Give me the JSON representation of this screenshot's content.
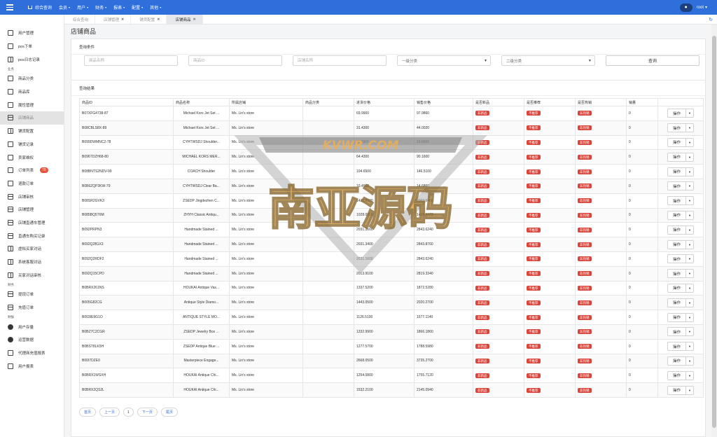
{
  "topbar": {
    "nav": [
      {
        "label": "综合查询",
        "home": true
      },
      {
        "label": "会员",
        "caret": true
      },
      {
        "label": "用户",
        "caret": true
      },
      {
        "label": "财务",
        "caret": true
      },
      {
        "label": "报表",
        "caret": true
      },
      {
        "label": "配置",
        "caret": true
      },
      {
        "label": "其他",
        "caret": true
      }
    ],
    "user": "root"
  },
  "sidebar": {
    "entries": [
      {
        "type": "item",
        "label": "用户管理",
        "icon": "user-doc-icon"
      },
      {
        "type": "item",
        "label": "pos下单",
        "icon": "pos-icon"
      },
      {
        "type": "item",
        "label": "pos日志记录",
        "icon": "log-icon"
      },
      {
        "type": "group",
        "label": "业务"
      },
      {
        "type": "item",
        "label": "商品分类",
        "icon": "laptop-icon"
      },
      {
        "type": "item",
        "label": "商品库",
        "icon": "box-icon"
      },
      {
        "type": "item",
        "label": "属性管理",
        "icon": "doc-icon"
      },
      {
        "type": "item",
        "label": "店铺商品",
        "icon": "store-icon",
        "active": true
      },
      {
        "type": "item",
        "label": "铺货配置",
        "icon": "config-icon"
      },
      {
        "type": "item",
        "label": "铺货记录",
        "icon": "record-icon"
      },
      {
        "type": "item",
        "label": "卖家维权",
        "icon": "keyboard-icon"
      },
      {
        "type": "item",
        "label": "订单列表",
        "icon": "order-icon",
        "badge": "70"
      },
      {
        "type": "item",
        "label": "退款订单",
        "icon": "refund-icon"
      },
      {
        "type": "item",
        "label": "店铺审核",
        "icon": "card-icon"
      },
      {
        "type": "item",
        "label": "店铺管理",
        "icon": "card-icon"
      },
      {
        "type": "item",
        "label": "店铺直通车管理",
        "icon": "card-icon"
      },
      {
        "type": "item",
        "label": "直通车购买记录",
        "icon": "card-icon"
      },
      {
        "type": "item",
        "label": "虚拟买家对话",
        "icon": "chat-icon"
      },
      {
        "type": "item",
        "label": "系统客服对话",
        "icon": "chat-icon"
      },
      {
        "type": "item",
        "label": "买家对话审核",
        "icon": "chat-icon"
      },
      {
        "type": "group",
        "label": "财务"
      },
      {
        "type": "item",
        "label": "提现订单",
        "icon": "card-icon"
      },
      {
        "type": "item",
        "label": "充值订单",
        "icon": "card-icon"
      },
      {
        "type": "group",
        "label": "财报"
      },
      {
        "type": "item",
        "label": "用户存量",
        "icon": "pie-icon"
      },
      {
        "type": "item",
        "label": "运营数据",
        "icon": "pie-icon"
      },
      {
        "type": "item",
        "label": "代理商充值报表",
        "icon": "sitemap-icon"
      },
      {
        "type": "item",
        "label": "用户报表",
        "icon": "list-icon"
      }
    ]
  },
  "tabs": [
    {
      "label": "综合查询",
      "closable": false
    },
    {
      "label": "店铺管理",
      "closable": true
    },
    {
      "label": "铺货配置",
      "closable": true
    },
    {
      "label": "店铺商品",
      "closable": true,
      "active": true
    }
  ],
  "page": {
    "title": "店铺商品"
  },
  "query": {
    "title": "查询条件",
    "fields": [
      {
        "placeholder": "商品名称"
      },
      {
        "placeholder": "商品ID"
      },
      {
        "placeholder": "店铺名称"
      }
    ],
    "selects": [
      "一级分类",
      "二级分类"
    ],
    "button": "查询"
  },
  "results": {
    "title": "查询结果",
    "columns": [
      "商品ID",
      "商品名称",
      "所属店铺",
      "商品分类",
      "进货价格",
      "销售价格",
      "是否新品",
      "是否推荐",
      "是否热销",
      "销量",
      ""
    ],
    "tags": {
      "new": "非新品",
      "rec": "不推荐",
      "hot": "非热销"
    },
    "op": "操作",
    "rows": [
      {
        "id": "B07XFG4738-87",
        "name": "Michael Kors Jet Set ...",
        "store": "Ms. Lin's store",
        "cat": "",
        "cost": "69.9900",
        "price": "97.9860",
        "sales": "0"
      },
      {
        "id": "B08CBLS8X-89",
        "name": "Michael Kors Jet Set ...",
        "store": "Ms. Lin's store",
        "cat": "",
        "cost": "31.4300",
        "price": "44.0020",
        "sales": "0"
      },
      {
        "id": "B099DWMNC2-78",
        "name": "CYHTWSDJ Shoulder...",
        "store": "Ms. Lin's store",
        "cat": "",
        "cost": "11.1900",
        "price": "15.6660",
        "sales": "0"
      },
      {
        "id": "B096TDZH68-80",
        "name": "MICHAEL KORS MER...",
        "store": "Ms. Lin's store",
        "cat": "",
        "cost": "64.4300",
        "price": "90.1600",
        "sales": "0"
      },
      {
        "id": "B08BNTS2NDV-99",
        "name": "COACH Shoulder",
        "store": "Ms. Lin's store",
        "cat": "",
        "cost": "104.6500",
        "price": "146.5100",
        "sales": "0"
      },
      {
        "id": "B0B6ZQP3KW-79",
        "name": "CYHTWSDJ Clear Ba...",
        "store": "Ms. Lin's store",
        "cat": "",
        "cost": "10.4900",
        "price": "14.6860",
        "sales": "0"
      },
      {
        "id": "B08SR2GVK3",
        "name": "ZSEDP Jingdezhen C...",
        "store": "Ms. Lin's store",
        "cat": "",
        "cost": "1431.8900",
        "price": "2003.6460",
        "sales": "0"
      },
      {
        "id": "B085BQ5T6M",
        "name": "ZHYH Classic Antiqu...",
        "store": "Ms. Lin's store",
        "cat": "",
        "cost": "1028.0000",
        "price": "1439.4420",
        "sales": "0"
      },
      {
        "id": "B092PRPN3",
        "name": "Handmade Stained ...",
        "store": "Ms. Lin's store",
        "cat": "",
        "cost": "2031.1600",
        "price": "2843.6240",
        "sales": "0"
      },
      {
        "id": "B092Q2B1X3",
        "name": "Handmade Stained ...",
        "store": "Ms. Lin's store",
        "cat": "",
        "cost": "2031.3400",
        "price": "2843.8760",
        "sales": "0"
      },
      {
        "id": "B092Q2RDF2",
        "name": "Handmade Stained ...",
        "store": "Ms. Lin's store",
        "cat": "",
        "cost": "2031.1600",
        "price": "2843.6240",
        "sales": "0"
      },
      {
        "id": "B092Q15CPD",
        "name": "Handmade Stained ...",
        "store": "Ms. Lin's store",
        "cat": "",
        "cost": "2013.9100",
        "price": "2819.3340",
        "sales": "0"
      },
      {
        "id": "B0BRX261NS",
        "name": "HOUKAI Antique Vas...",
        "store": "Ms. Lin's store",
        "cat": "",
        "cost": "1337.5200",
        "price": "1872.5280",
        "sales": "0"
      },
      {
        "id": "B005G82CG",
        "name": "Antique Style Diamo...",
        "store": "Ms. Lin's store",
        "cat": "",
        "cost": "1443.0500",
        "price": "2020.2700",
        "sales": "0"
      },
      {
        "id": "B003IE9G1O",
        "name": "ANTIQUE STYLE MO...",
        "store": "Ms. Lin's store",
        "cat": "",
        "cost": "1126.5100",
        "price": "1577.1140",
        "sales": "0"
      },
      {
        "id": "B0BZ7C2CGR",
        "name": "ZSEDP Jewelry Box ...",
        "store": "Ms. Lin's store",
        "cat": "",
        "cost": "1332.9900",
        "price": "1866.1860",
        "sales": "0"
      },
      {
        "id": "B0BST8LK5H",
        "name": "ZSEDP Antique Blue ...",
        "store": "Ms. Lin's store",
        "cat": "",
        "cost": "1277.5700",
        "price": "1788.5980",
        "sales": "0"
      },
      {
        "id": "B00I7DZE0",
        "name": "Masterpiece Engage...",
        "store": "Ms. Lin's store",
        "cat": "",
        "cost": "2668.0500",
        "price": "3735.2700",
        "sales": "0"
      },
      {
        "id": "B0BRX1WSXH",
        "name": "HOUKAI Antique Chi...",
        "store": "Ms. Lin's store",
        "cat": "",
        "cost": "1254.0800",
        "price": "1755.7120",
        "sales": "0"
      },
      {
        "id": "B0BRX2QS2L",
        "name": "HOUKAI Antique Chi...",
        "store": "Ms. Lin's store",
        "cat": "",
        "cost": "1532.2100",
        "price": "2145.0940",
        "sales": "0"
      }
    ]
  },
  "pager": {
    "first": "首页",
    "prev": "上一页",
    "page": "1",
    "next": "下一页",
    "last": "尾页"
  },
  "watermark": {
    "top": "KVWR.COM",
    "main": "南亚源码"
  },
  "colors": {
    "brand": "#2e6fdc",
    "tag": "#d9453b",
    "badge": "#e5533c"
  }
}
